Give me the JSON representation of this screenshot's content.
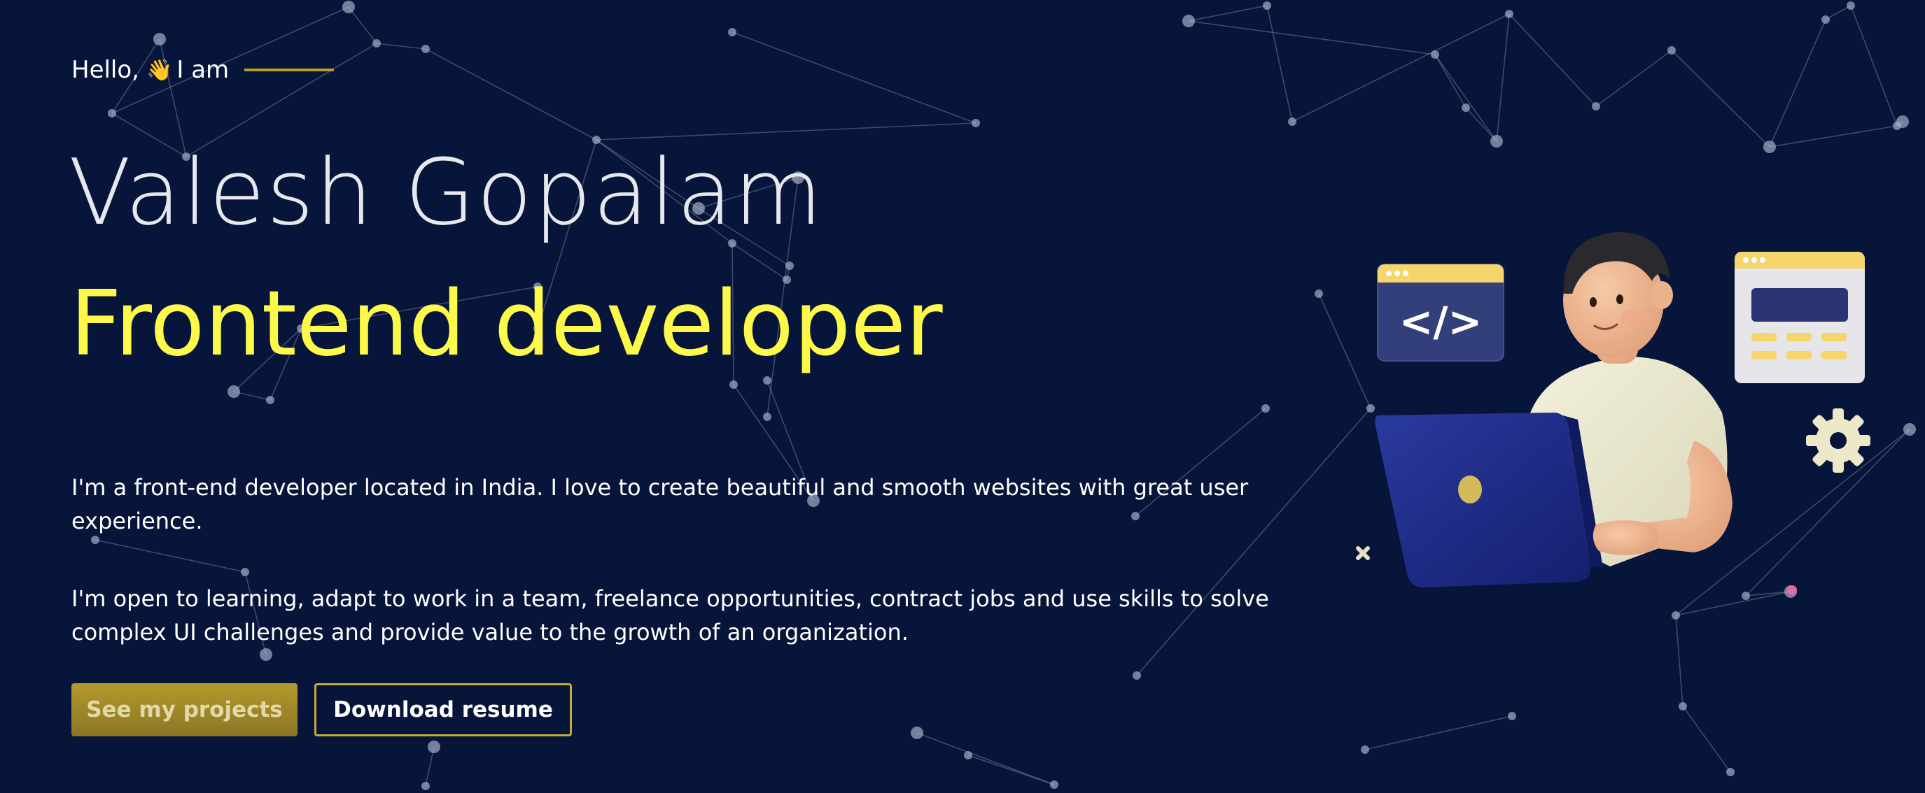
{
  "hero": {
    "greeting_prefix": "Hello,",
    "greeting_emoji": "👋",
    "greeting_suffix": "I am",
    "name": "Valesh Gopalam",
    "role": "Frontend developer",
    "paragraphs": [
      "I'm a front-end developer located in India. I love to create beautiful and smooth websites with great user experience.",
      "I'm open to learning, adapt to work in a team, freelance opportunities, contract jobs and use skills to solve complex UI challenges and provide value to the growth of an organization."
    ],
    "buttons": {
      "projects": "See my projects",
      "resume": "Download resume"
    }
  },
  "illustration": {
    "code_symbol": "</>",
    "icons": [
      "code-window-icon",
      "layout-window-icon",
      "gear-icon",
      "laptop-icon",
      "developer-avatar"
    ]
  },
  "theme": {
    "background": "#061539",
    "accent_yellow": "#fdf94a",
    "accent_gold": "#b49a2c"
  }
}
